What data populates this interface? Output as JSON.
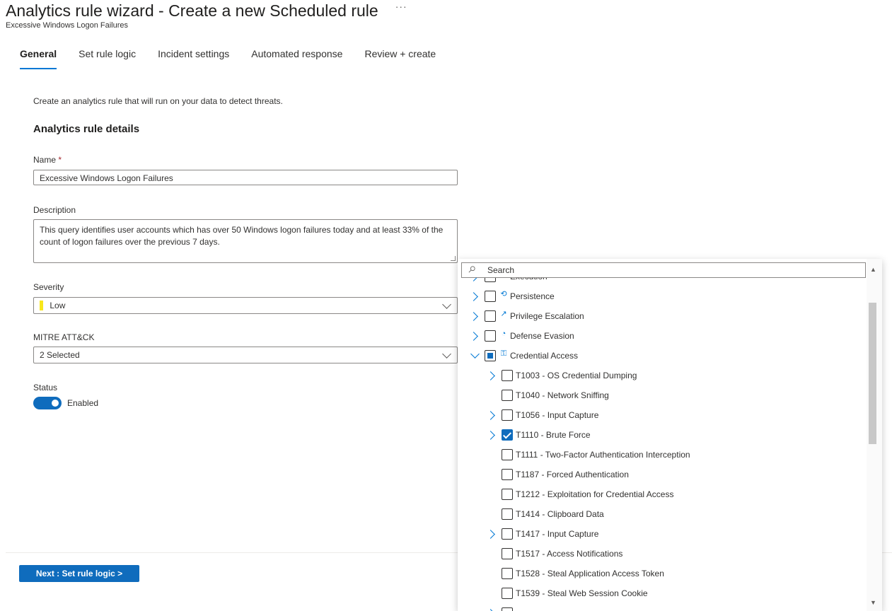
{
  "header": {
    "title": "Analytics rule wizard - Create a new Scheduled rule",
    "more": "···",
    "subtitle": "Excessive Windows Logon Failures"
  },
  "tabs": [
    {
      "label": "General",
      "active": true
    },
    {
      "label": "Set rule logic",
      "active": false
    },
    {
      "label": "Incident settings",
      "active": false
    },
    {
      "label": "Automated response",
      "active": false
    },
    {
      "label": "Review + create",
      "active": false
    }
  ],
  "form": {
    "intro": "Create an analytics rule that will run on your data to detect threats.",
    "section_title": "Analytics rule details",
    "name_label": "Name",
    "required_mark": "*",
    "name_value": "Excessive Windows Logon Failures",
    "description_label": "Description",
    "description_value": "This query identifies user accounts which has over 50 Windows logon failures today and at least 33% of the count of logon failures over the previous 7 days.",
    "severity_label": "Severity",
    "severity_value": "Low",
    "severity_color": "#f8e71c",
    "mitre_label": "MITRE ATT&CK",
    "mitre_value": "2 Selected",
    "status_label": "Status",
    "status_value": "Enabled",
    "status_enabled": true
  },
  "footer": {
    "next_button": "Next : Set rule logic >"
  },
  "mitre_popup": {
    "search_placeholder": "Search",
    "partial_row_label": "Execution",
    "tactics": [
      {
        "label": "Persistence",
        "icon": "persistence-icon",
        "expanded": false,
        "state": "unchecked"
      },
      {
        "label": "Privilege Escalation",
        "icon": "privilege-escalation-icon",
        "expanded": false,
        "state": "unchecked"
      },
      {
        "label": "Defense Evasion",
        "icon": "defense-evasion-icon",
        "expanded": false,
        "state": "unchecked"
      },
      {
        "label": "Credential Access",
        "icon": "credential-access-icon",
        "expanded": true,
        "state": "partial"
      }
    ],
    "techniques": [
      {
        "label": "T1003 - OS Credential Dumping",
        "has_children": true,
        "checked": false
      },
      {
        "label": "T1040 - Network Sniffing",
        "has_children": false,
        "checked": false
      },
      {
        "label": "T1056 - Input Capture",
        "has_children": true,
        "checked": false
      },
      {
        "label": "T1110 - Brute Force",
        "has_children": true,
        "checked": true
      },
      {
        "label": "T1111 - Two-Factor Authentication Interception",
        "has_children": false,
        "checked": false
      },
      {
        "label": "T1187 - Forced Authentication",
        "has_children": false,
        "checked": false
      },
      {
        "label": "T1212 - Exploitation for Credential Access",
        "has_children": false,
        "checked": false
      },
      {
        "label": "T1414 - Clipboard Data",
        "has_children": false,
        "checked": false
      },
      {
        "label": "T1417 - Input Capture",
        "has_children": true,
        "checked": false
      },
      {
        "label": "T1517 - Access Notifications",
        "has_children": false,
        "checked": false
      },
      {
        "label": "T1528 - Steal Application Access Token",
        "has_children": false,
        "checked": false
      },
      {
        "label": "T1539 - Steal Web Session Cookie",
        "has_children": false,
        "checked": false
      }
    ]
  }
}
